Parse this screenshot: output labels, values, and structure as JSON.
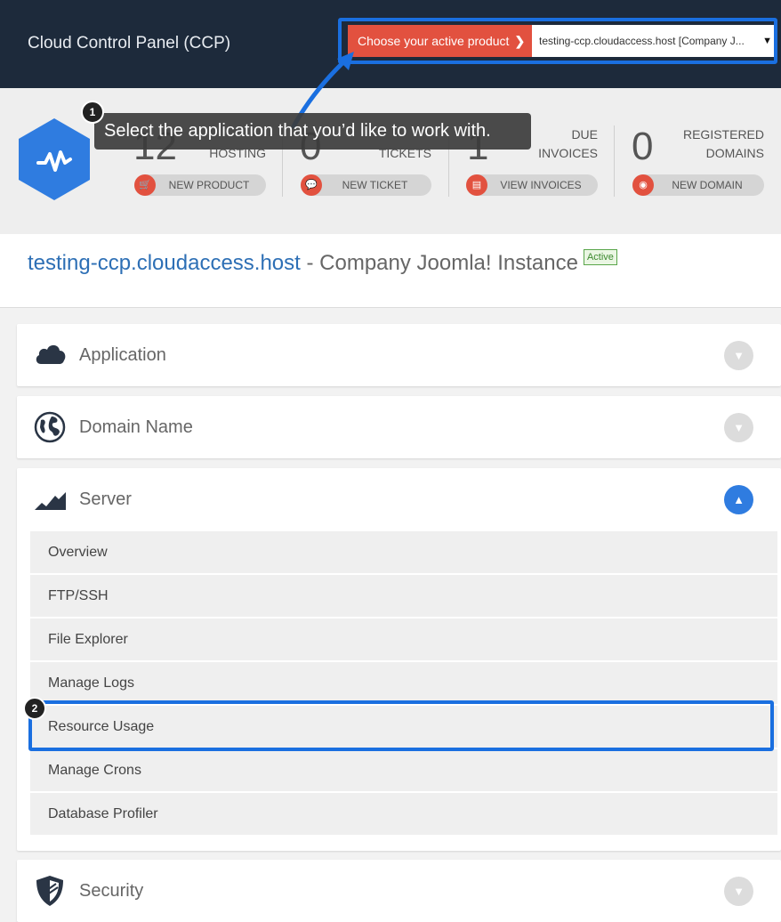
{
  "header": {
    "title": "Cloud Control Panel (CCP)",
    "product_label": "Choose your active product",
    "product_selected": "testing-ccp.cloudaccess.host [Company J..."
  },
  "tooltip": {
    "step1": "1",
    "text": "Select the application that you’d like to work with.",
    "step2": "2"
  },
  "stats": [
    {
      "number": "12",
      "label1": "",
      "label2": "HOSTING",
      "button": "NEW PRODUCT"
    },
    {
      "number": "0",
      "label1": "",
      "label2": "TICKETS",
      "button": "NEW TICKET"
    },
    {
      "number": "1",
      "label1": "DUE",
      "label2": "INVOICES",
      "button": "VIEW INVOICES"
    },
    {
      "number": "0",
      "label1": "REGISTERED",
      "label2": "DOMAINS",
      "button": "NEW DOMAIN"
    }
  ],
  "site": {
    "host": "testing-ccp.cloudaccess.host",
    "name": " - Company Joomla! Instance",
    "status": "Active"
  },
  "panels": {
    "application": "Application",
    "domain": "Domain Name",
    "server": "Server",
    "security": "Security"
  },
  "server_items": [
    "Overview",
    "FTP/SSH",
    "File Explorer",
    "Manage Logs",
    "Resource Usage",
    "Manage Crons",
    "Database Profiler"
  ],
  "colors": {
    "accent": "#2f7ce0",
    "brand_red": "#e2513f",
    "header_bg": "#1d2a3b",
    "highlight": "#1a6fe0"
  }
}
